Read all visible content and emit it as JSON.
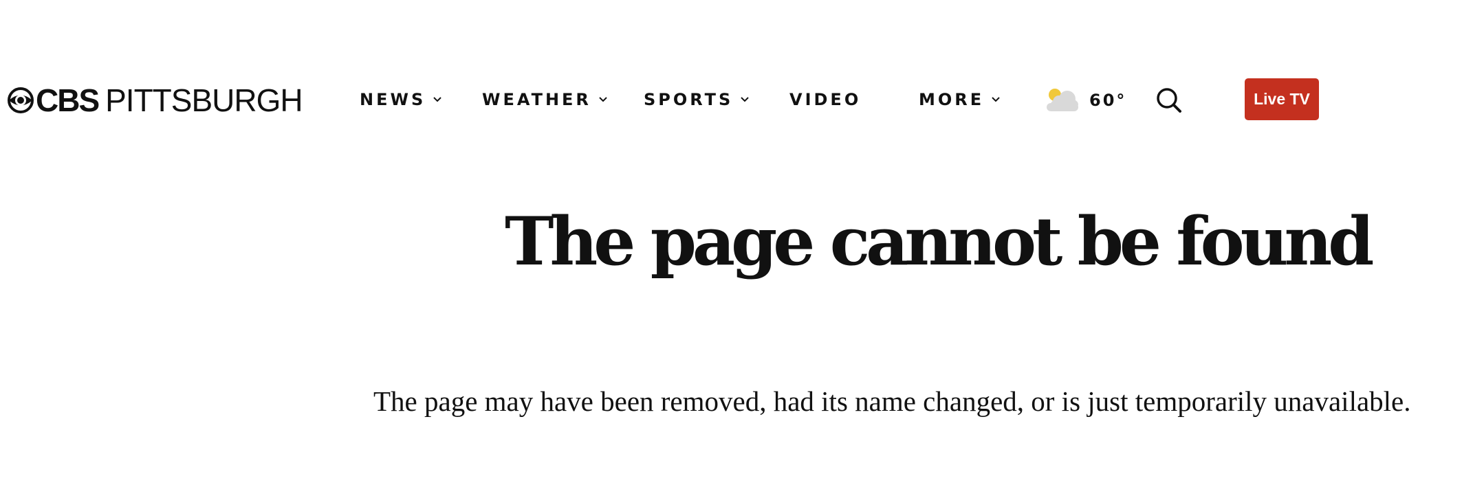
{
  "header": {
    "logo": {
      "brand": "CBS",
      "city": "PITTSBURGH"
    },
    "nav": [
      {
        "label": "NEWS",
        "has_dropdown": true
      },
      {
        "label": "WEATHER",
        "has_dropdown": true
      },
      {
        "label": "SPORTS",
        "has_dropdown": true
      },
      {
        "label": "VIDEO",
        "has_dropdown": false
      },
      {
        "label": "MORE",
        "has_dropdown": true
      }
    ],
    "weather": {
      "icon": "partly-cloudy-icon",
      "temperature": "60°"
    },
    "search_icon": "search-icon",
    "live_tv_label": "Live TV",
    "live_tv_color": "#c4301f"
  },
  "main": {
    "title": "The page cannot be found",
    "message": "The page may have been removed, had its name changed, or is just temporarily unavailable."
  }
}
